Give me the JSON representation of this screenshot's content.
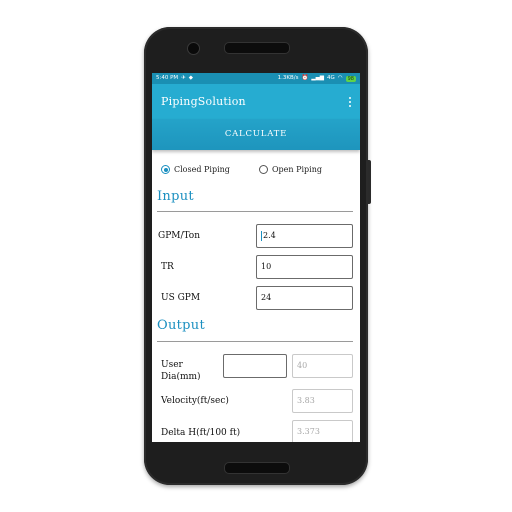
{
  "status": {
    "time": "5:40 PM",
    "speed": "1.3KB/s",
    "network": "4G",
    "battery": "98"
  },
  "app": {
    "title": "PipingSolution",
    "calculate_label": "CALCULATE"
  },
  "mode": {
    "options": [
      {
        "label": "Closed Piping",
        "selected": true
      },
      {
        "label": "Open Piping",
        "selected": false
      }
    ]
  },
  "input": {
    "heading": "Input",
    "gpm_ton": {
      "label": "GPM/Ton",
      "value": "2.4"
    },
    "tr": {
      "label": "TR",
      "value": "10"
    },
    "us_gpm": {
      "label": "US GPM",
      "value": "24"
    }
  },
  "output": {
    "heading": "Output",
    "user_dia": {
      "label_line1": "User",
      "label_line2": "Dia(mm)",
      "value": "",
      "result": "40"
    },
    "velocity": {
      "label": "Velocity(ft/sec)",
      "value": "3.83"
    },
    "delta_h": {
      "label": "Delta H(ft/100 ft)",
      "value": "3.373"
    }
  },
  "colors": {
    "accent": "#1a8fc0",
    "appbar": "#26acd1",
    "statusbar": "#1a8fb3"
  }
}
